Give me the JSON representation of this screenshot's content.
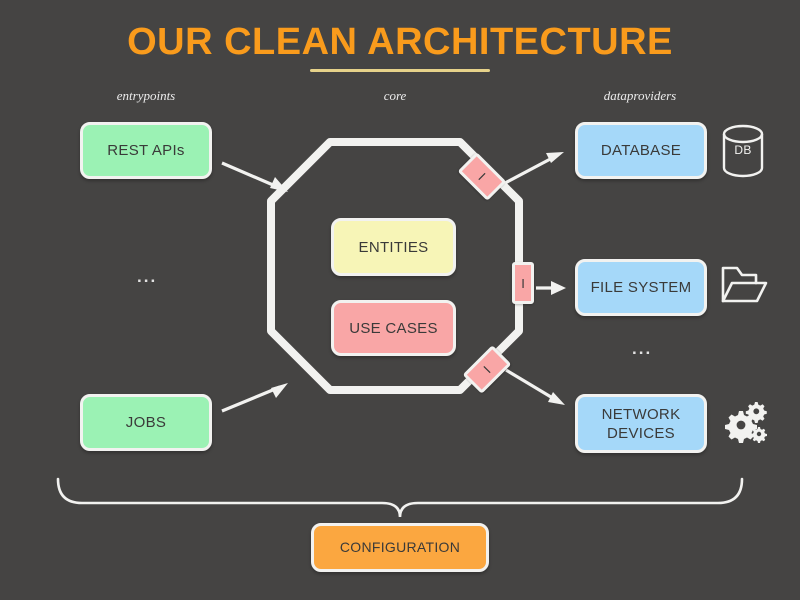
{
  "header": {
    "title": "OUR CLEAN ARCHITECTURE"
  },
  "columns": {
    "entrypoints": "entrypoints",
    "core": "core",
    "dataproviders": "dataproviders"
  },
  "entrypoints": {
    "nodes": [
      {
        "label": "REST APIs"
      },
      {
        "label": "JOBS"
      }
    ],
    "ellipsis": "..."
  },
  "core": {
    "nodes": [
      {
        "label": "ENTITIES"
      },
      {
        "label": "USE CASES"
      }
    ],
    "ports": [
      {
        "label": "I",
        "name": "gateway-port-top"
      },
      {
        "label": "I",
        "name": "gateway-port-middle"
      },
      {
        "label": "I",
        "name": "gateway-port-bottom"
      }
    ]
  },
  "dataproviders": {
    "nodes": [
      {
        "label": "DATABASE",
        "icon": "database-cylinder-icon",
        "icon_label": "DB"
      },
      {
        "label": "FILE SYSTEM",
        "icon": "open-folder-icon",
        "icon_label": ""
      },
      {
        "label": "NETWORK DEVICES",
        "icon": "gears-icon",
        "icon_label": ""
      }
    ],
    "ellipsis": "..."
  },
  "footer": {
    "configuration_label": "CONFIGURATION"
  },
  "colors": {
    "background": "#454443",
    "title": "#F99B1C",
    "title_rule": "#E6D28A",
    "entrypoint_box": "#9BF2B4",
    "dataprovider_box": "#A5D8F9",
    "entities_box": "#F7F5B7",
    "usecases_box": "#F9A6A6",
    "port_box": "#F9A6A6",
    "configuration_box": "#FBA740",
    "stroke": "#F2F2F0",
    "text": "#3A3A39"
  }
}
